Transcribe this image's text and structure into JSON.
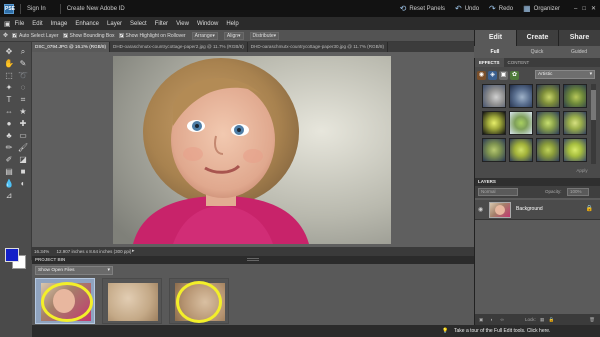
{
  "titlebar": {
    "app_badge": "PSE",
    "sign_in": "Sign In",
    "create_id": "Create New Adobe ID",
    "reset_panels": "Reset Panels",
    "undo": "Undo",
    "redo": "Redo",
    "organizer": "Organizer"
  },
  "menubar": {
    "items": [
      "File",
      "Edit",
      "Image",
      "Enhance",
      "Layer",
      "Select",
      "Filter",
      "View",
      "Window",
      "Help"
    ]
  },
  "options": {
    "auto_select": "Auto Select Layer",
    "show_bounding": "Show Bounding Box",
    "show_highlight": "Show Highlight on Rollover",
    "arrange": "Arrange",
    "align": "Align",
    "distribute": "Distribute"
  },
  "doc_tabs": [
    "DSC_0794.JPG @ 16.2% (RGB/8)",
    "DHD-oaraschmutx-countrycottage-paper2.jpg @ 11.7% (RGB/8)",
    "DHD-oaraschmutx-countrycottage-paper30.jpg @ 11.7% (RGB/8)"
  ],
  "status": {
    "zoom": "16.34%",
    "dimensions": "12.907 inches x 8.64 inches (300 ppi)"
  },
  "project_bin": {
    "title": "PROJECT BIN",
    "show": "Show Open Files"
  },
  "mode_tabs": [
    "Edit",
    "Create",
    "Share"
  ],
  "sub_tabs": [
    "Full",
    "Quick",
    "Guided"
  ],
  "effects": {
    "tabs": [
      "EFFECTS",
      "CONTENT"
    ],
    "category": "Artistic",
    "apply": "Apply"
  },
  "layers": {
    "title": "LAYERS",
    "blend": "Normal",
    "opacity_label": "Opacity:",
    "opacity_value": "100%",
    "background_name": "Background",
    "lock_label": "Lock:"
  },
  "bottom": {
    "tip": "Take a tour of the Full Edit tools. Click here."
  },
  "colors": {
    "foreground": "#1320c8",
    "background": "#ffffff",
    "annotation": "#f3ef2a"
  }
}
